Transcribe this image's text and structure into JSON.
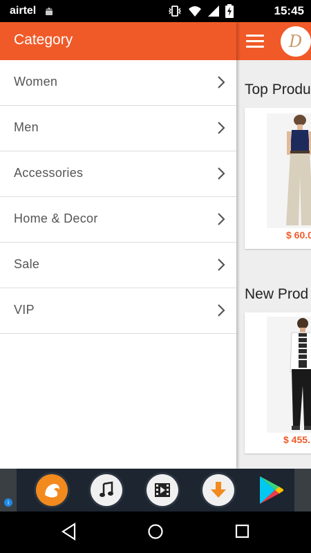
{
  "status_bar": {
    "carrier": "airtel",
    "time": "15:45",
    "icons": [
      "android-icon",
      "vibrate-icon",
      "wifi-icon",
      "signal-icon",
      "battery-icon"
    ]
  },
  "drawer": {
    "title": "Category",
    "items": [
      {
        "label": "Women"
      },
      {
        "label": "Men"
      },
      {
        "label": "Accessories"
      },
      {
        "label": "Home & Decor"
      },
      {
        "label": "Sale"
      },
      {
        "label": "VIP"
      }
    ]
  },
  "content": {
    "sections": [
      {
        "title": "Top Produ",
        "price": "$ 60.0"
      },
      {
        "title": "New Prod",
        "price": "$ 455."
      }
    ]
  },
  "colors": {
    "accent": "#f05a28",
    "content_bg": "#eeeeee"
  }
}
